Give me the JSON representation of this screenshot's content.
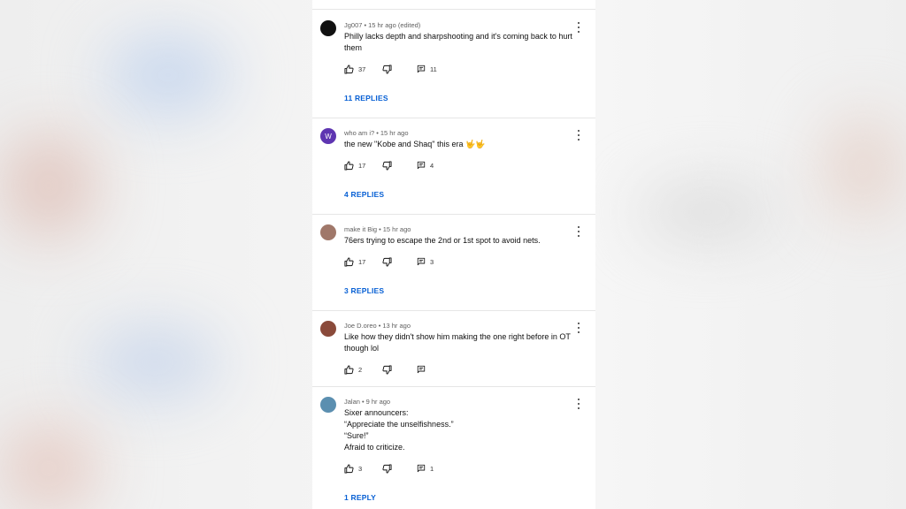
{
  "comments": [
    {
      "author": "Jg007",
      "time": "15 hr ago (edited)",
      "text": [
        "Philly lacks depth and sharpshooting and it's coming back to hurt",
        "them"
      ],
      "likes": "37",
      "reply_count": "11",
      "replies_label": "11 REPLIES",
      "avatar_color": "#111111",
      "avatar_letter": ""
    },
    {
      "author": "who am i?",
      "time": "15 hr ago",
      "text": [
        "the new \"Kobe and Shaq\" this era 🤟🤟"
      ],
      "likes": "17",
      "reply_count": "4",
      "replies_label": "4 REPLIES",
      "avatar_color": "#5e35b1",
      "avatar_letter": "W"
    },
    {
      "author": "make it Big",
      "time": "15 hr ago",
      "text": [
        "76ers trying to escape the 2nd or 1st spot to avoid nets."
      ],
      "likes": "17",
      "reply_count": "3",
      "replies_label": "3 REPLIES",
      "avatar_color": "#a0786a",
      "avatar_letter": ""
    },
    {
      "author": "Joe D.oreo",
      "time": "13 hr ago",
      "text": [
        "Like how they didn't show him making the one right before in OT",
        "though lol"
      ],
      "likes": "2",
      "reply_count": "",
      "replies_label": "",
      "avatar_color": "#8a4a3a",
      "avatar_letter": ""
    },
    {
      "author": "Jalan",
      "time": "9 hr ago",
      "text": [
        "Sixer announcers:",
        "“Appreciate the unselfishness.”",
        "“Sure!”",
        "Afraid to criticize."
      ],
      "likes": "3",
      "reply_count": "1",
      "replies_label": "1 REPLY",
      "avatar_color": "#5b8fb0",
      "avatar_letter": ""
    }
  ],
  "meta_separator": "•"
}
